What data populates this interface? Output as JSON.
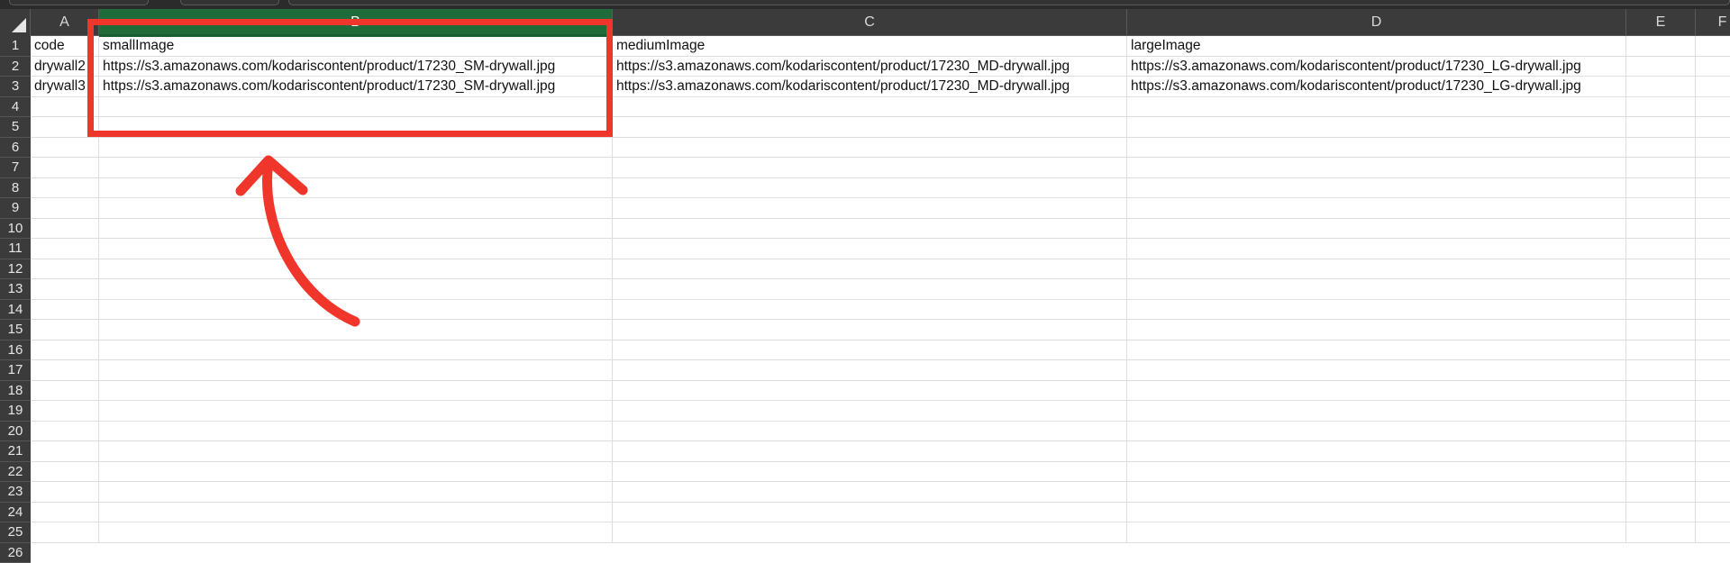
{
  "columns": [
    "A",
    "B",
    "C",
    "D",
    "E",
    "F"
  ],
  "rows": [
    "1",
    "2",
    "3",
    "4",
    "5",
    "6",
    "7",
    "8",
    "9",
    "10",
    "11",
    "12",
    "13",
    "14",
    "15",
    "16",
    "17",
    "18",
    "19",
    "20",
    "21",
    "22",
    "23",
    "24",
    "25",
    "26"
  ],
  "cells": {
    "r1": {
      "a": "code",
      "b": "smallImage",
      "c": "mediumImage",
      "d": "largeImage"
    },
    "r2": {
      "a": "drywall2",
      "b": "https://s3.amazonaws.com/kodariscontent/product/17230_SM-drywall.jpg",
      "c": "https://s3.amazonaws.com/kodariscontent/product/17230_MD-drywall.jpg",
      "d": "https://s3.amazonaws.com/kodariscontent/product/17230_LG-drywall.jpg"
    },
    "r3": {
      "a": "drywall3",
      "b": "https://s3.amazonaws.com/kodariscontent/product/17230_SM-drywall.jpg",
      "c": "https://s3.amazonaws.com/kodariscontent/product/17230_MD-drywall.jpg",
      "d": "https://s3.amazonaws.com/kodariscontent/product/17230_LG-drywall.jpg"
    }
  },
  "selected_column": "B",
  "colors": {
    "selected_header": "#1f6b3a",
    "annotation": "#f0362b",
    "header_bg": "#3b3b3b"
  }
}
